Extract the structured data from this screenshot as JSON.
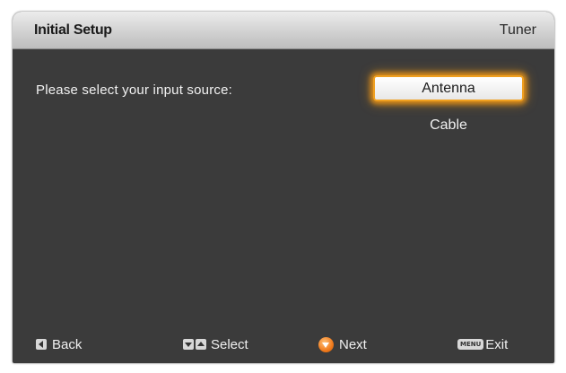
{
  "header": {
    "title": "Initial Setup",
    "section": "Tuner"
  },
  "prompt": "Please select your input source:",
  "options": [
    {
      "label": "Antenna",
      "selected": true
    },
    {
      "label": "Cable",
      "selected": false
    }
  ],
  "footer": {
    "back_label": "Back",
    "select_label": "Select",
    "next_label": "Next",
    "menu_key_label": "MENU",
    "exit_label": "Exit"
  },
  "colors": {
    "panel": "#3b3b3b",
    "highlight": "#f0a020"
  }
}
